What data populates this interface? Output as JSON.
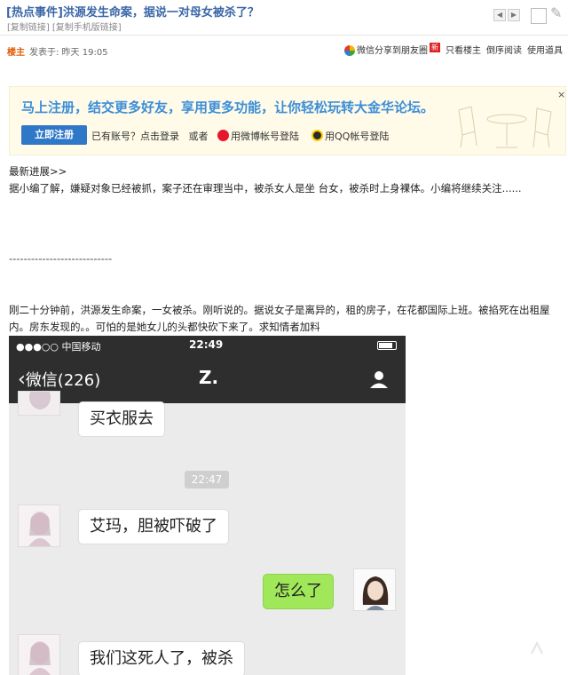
{
  "header": {
    "title": "[热点事件]洪源发生命案，据说一对母女被杀了？",
    "copy_link": "[复制链接]",
    "copy_mobile_link": "[复制手机版链接]",
    "prev_icon": "prev-page-icon",
    "next_icon": "next-page-icon"
  },
  "post_meta": {
    "role": "楼主",
    "posted": "发表于: 昨天 19:05",
    "share_wechat": "微信分享到朋友圈",
    "new_badge": "新",
    "only_author": "只看楼主",
    "reverse_read": "倒序阅读",
    "tools": "使用道具"
  },
  "banner": {
    "headline": "马上注册，结交更多好友，享用更多功能，让你轻松玩转大金华论坛。",
    "register_button": "立即注册",
    "have_account": "已有账号？",
    "login_link": "点击登录",
    "or": "或者",
    "weibo_login": "用微博帐号登陆",
    "qq_login": "用QQ帐号登陆",
    "close": "×"
  },
  "content": {
    "update_heading": "最新进展>>",
    "update_text": "据小编了解，嫌疑对象已经被抓，案子还在审理当中，被杀女人是坐 台女，被杀时上身裸体。小编将继续关注......",
    "divider": "----------------------------",
    "original_text": "刚二十分钟前，洪源发生命案，一女被杀。刚听说的。据说女子是离异的，租的房子，在花都国际上班。被掐死在出租屋内。房东发现的。。可怕的是她女儿的头都快砍下来了。求知情者加料"
  },
  "phone": {
    "carrier": "●●●○○ 中国移动",
    "time": "22:49",
    "back_label": "微信(226)",
    "chat_title": "Z.",
    "messages": [
      {
        "side": "left",
        "text": "买衣服去"
      },
      {
        "side": "center",
        "text": "22:47"
      },
      {
        "side": "left",
        "text": "艾玛，胆被吓破了"
      },
      {
        "side": "right",
        "text": "怎么了"
      },
      {
        "side": "left",
        "text": "我们这死人了，被杀"
      }
    ]
  },
  "colors": {
    "title_blue": "#3a66a7",
    "banner_blue": "#3c8ed8",
    "wechat_green": "#a0e75a",
    "phone_bar": "#2e2e2e"
  }
}
